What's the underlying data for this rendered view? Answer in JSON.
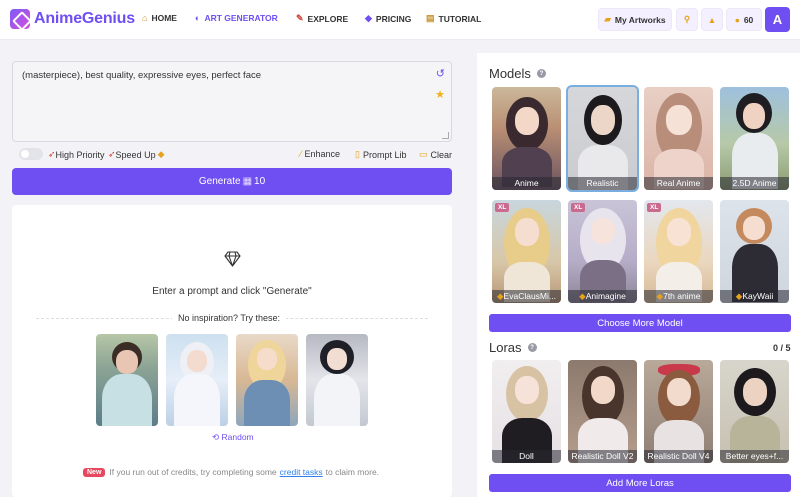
{
  "app": {
    "brand": "AnimeGenius",
    "avatar_letter": "A"
  },
  "nav": [
    {
      "label": "HOME",
      "icon": "home-icon",
      "glyph": "⌂"
    },
    {
      "label": "ART GENERATOR",
      "icon": "palette-icon",
      "glyph": "◐",
      "active": true
    },
    {
      "label": "EXPLORE",
      "icon": "brush-icon",
      "glyph": "✎"
    },
    {
      "label": "PRICING",
      "icon": "diamond-icon",
      "glyph": "◆"
    },
    {
      "label": "TUTORIAL",
      "icon": "book-icon",
      "glyph": "▤"
    }
  ],
  "header": {
    "my_artworks": "My Artworks",
    "credits": "60"
  },
  "prompt": {
    "value": "(masterpiece), best quality, expressive eyes, perfect face"
  },
  "options": {
    "high_priority": "High Priority",
    "speed_up": "Speed Up",
    "enhance": "Enhance",
    "prompt_lib": "Prompt Lib",
    "clear": "Clear"
  },
  "generate": {
    "label": "Generate",
    "cost": "10"
  },
  "results": {
    "empty_message": "Enter a prompt and click \"Generate\"",
    "no_inspiration": "No inspiration? Try these:",
    "random": "Random",
    "new_badge": "New",
    "credit_note_before": "If you run out of credits, try completing some",
    "credit_link": "credit tasks",
    "credit_note_after": "to claim more."
  },
  "models": {
    "title": "Models",
    "items": [
      {
        "label": "Anime"
      },
      {
        "label": "Realistic",
        "selected": true
      },
      {
        "label": "Real Anime"
      },
      {
        "label": "2.5D Anime"
      },
      {
        "label": "EvaClausMi...",
        "xl": "XL"
      },
      {
        "label": "Animagine",
        "xl": "XL"
      },
      {
        "label": "7th anime",
        "xl": "XL"
      },
      {
        "label": "KayWaii"
      }
    ],
    "choose_more": "Choose More Model"
  },
  "loras": {
    "title": "Loras",
    "count": "0 / 5",
    "items": [
      {
        "label": "Doll"
      },
      {
        "label": "Realistic Doll V2"
      },
      {
        "label": "Realistic Doll V4"
      },
      {
        "label": "Better eyes+f..."
      }
    ],
    "add_more": "Add More Loras"
  }
}
